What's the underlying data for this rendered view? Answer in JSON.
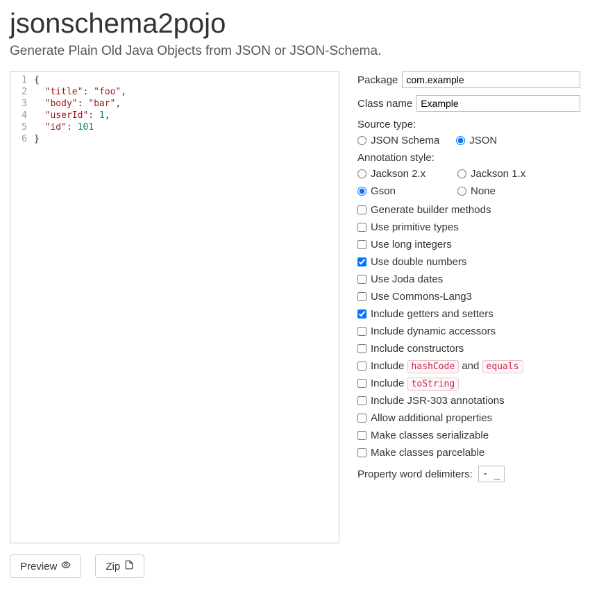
{
  "header": {
    "title": "jsonschema2pojo",
    "subtitle": "Generate Plain Old Java Objects from JSON or JSON-Schema."
  },
  "editor": {
    "line_numbers": [
      "1",
      "2",
      "3",
      "4",
      "5",
      "6"
    ],
    "lines": [
      [
        {
          "t": "{",
          "c": "brace"
        }
      ],
      [
        {
          "t": "  ",
          "c": "plain"
        },
        {
          "t": "\"title\"",
          "c": "key"
        },
        {
          "t": ": ",
          "c": "punct"
        },
        {
          "t": "\"foo\"",
          "c": "str"
        },
        {
          "t": ",",
          "c": "punct"
        }
      ],
      [
        {
          "t": "  ",
          "c": "plain"
        },
        {
          "t": "\"body\"",
          "c": "key"
        },
        {
          "t": ": ",
          "c": "punct"
        },
        {
          "t": "\"bar\"",
          "c": "str"
        },
        {
          "t": ",",
          "c": "punct"
        }
      ],
      [
        {
          "t": "  ",
          "c": "plain"
        },
        {
          "t": "\"userId\"",
          "c": "key"
        },
        {
          "t": ": ",
          "c": "punct"
        },
        {
          "t": "1",
          "c": "num"
        },
        {
          "t": ",",
          "c": "punct"
        }
      ],
      [
        {
          "t": "  ",
          "c": "plain"
        },
        {
          "t": "\"id\"",
          "c": "key"
        },
        {
          "t": ": ",
          "c": "punct"
        },
        {
          "t": "101",
          "c": "num"
        }
      ],
      [
        {
          "t": "}",
          "c": "brace"
        }
      ]
    ]
  },
  "form": {
    "package_label": "Package",
    "package_value": "com.example",
    "classname_label": "Class name",
    "classname_value": "Example",
    "source_type_label": "Source type:",
    "source_type": {
      "options": [
        {
          "label": "JSON Schema",
          "checked": false
        },
        {
          "label": "JSON",
          "checked": true
        }
      ]
    },
    "annotation_label": "Annotation style:",
    "annotation": {
      "options": [
        {
          "label": "Jackson 2.x",
          "checked": false
        },
        {
          "label": "Jackson 1.x",
          "checked": false
        },
        {
          "label": "Gson",
          "checked": true
        },
        {
          "label": "None",
          "checked": false
        }
      ]
    },
    "checks": [
      {
        "label": "Generate builder methods",
        "checked": false
      },
      {
        "label": "Use primitive types",
        "checked": false
      },
      {
        "label": "Use long integers",
        "checked": false
      },
      {
        "label": "Use double numbers",
        "checked": true
      },
      {
        "label": "Use Joda dates",
        "checked": false
      },
      {
        "label": "Use Commons-Lang3",
        "checked": false
      },
      {
        "label": "Include getters and setters",
        "checked": true
      },
      {
        "label": "Include dynamic accessors",
        "checked": false
      },
      {
        "label": "Include constructors",
        "checked": false
      }
    ],
    "check_hashcode": {
      "pre": "Include ",
      "code1": "hashCode",
      "mid": " and ",
      "code2": "equals",
      "checked": false
    },
    "check_tostring": {
      "pre": "Include ",
      "code": "toString",
      "checked": false
    },
    "checks_after": [
      {
        "label": "Include JSR-303 annotations",
        "checked": false
      },
      {
        "label": "Allow additional properties",
        "checked": false
      },
      {
        "label": "Make classes serializable",
        "checked": false
      },
      {
        "label": "Make classes parcelable",
        "checked": false
      }
    ],
    "delimiters_label": "Property word delimiters:",
    "delimiters_value": "- _"
  },
  "buttons": {
    "preview": "Preview",
    "zip": "Zip"
  }
}
